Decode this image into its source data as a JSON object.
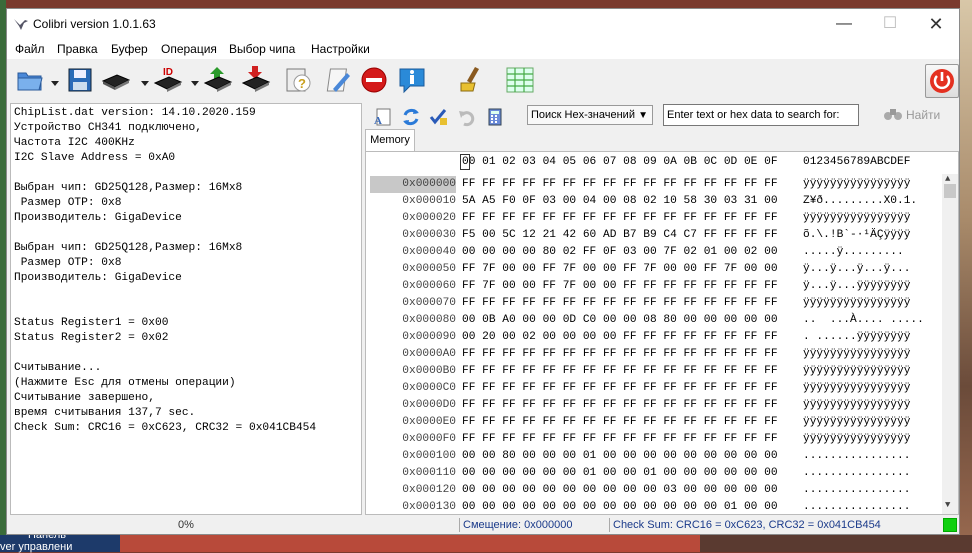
{
  "window": {
    "title": "Colibri version 1.0.1.63",
    "close_label": "✕",
    "min_label": "—",
    "max_label": "☐"
  },
  "menu": [
    "Файл",
    "Правка",
    "Буфер",
    "Операция",
    "Выбор чипа",
    "Настройки"
  ],
  "log_lines": [
    "ChipList.dat version: 14.10.2020.159",
    "Устройство CH341 подключено,",
    "Частота I2C 400KHz",
    "I2C Slave Address = 0xA0",
    "",
    "Выбран чип: GD25Q128,Размер: 16Mx8",
    " Размер OTP: 0x8",
    "Производитель: GigaDevice",
    "",
    "Выбран чип: GD25Q128,Размер: 16Mx8",
    " Размер OTP: 0x8",
    "Производитель: GigaDevice",
    "",
    "",
    "Status Register1 = 0x00",
    "Status Register2 = 0x02",
    "",
    "Считывание...",
    "(Нажмите Esc для отмены операции)",
    "Считывание завершено,",
    "время считывания 137,7 sec.",
    "Check Sum: CRC16 = 0xC623, CRC32 = 0x041CB454"
  ],
  "progress": "0%",
  "search": {
    "mode": "Поиск Hex-значений",
    "placeholder": "Enter text or hex data to search for:",
    "find_label": "Найти"
  },
  "tab": "Memory",
  "hex": {
    "columns": "00 01 02 03 04 05 06 07 08 09 0A 0B 0C 0D 0E 0F",
    "ascii_header": "0123456789ABCDEF",
    "rows": [
      {
        "addr": "0x000000",
        "bytes": "FF FF FF FF FF FF FF FF FF FF FF FF FF FF FF FF",
        "ascii": "ÿÿÿÿÿÿÿÿÿÿÿÿÿÿÿÿ"
      },
      {
        "addr": "0x000010",
        "bytes": "5A A5 F0 0F 03 00 04 00 08 02 10 58 30 03 31 00",
        "ascii": "Z¥ð.........X0.1."
      },
      {
        "addr": "0x000020",
        "bytes": "FF FF FF FF FF FF FF FF FF FF FF FF FF FF FF FF",
        "ascii": "ÿÿÿÿÿÿÿÿÿÿÿÿÿÿÿÿ"
      },
      {
        "addr": "0x000030",
        "bytes": "F5 00 5C 12 21 42 60 AD B7 B9 C4 C7 FF FF FF FF",
        "ascii": "õ.\\.!B`-·¹ÄÇÿÿÿÿ"
      },
      {
        "addr": "0x000040",
        "bytes": "00 00 00 00 80 02 FF 0F 03 00 7F 02 01 00 02 00",
        "ascii": ".....ÿ........."
      },
      {
        "addr": "0x000050",
        "bytes": "FF 7F 00 00 FF 7F 00 00 FF 7F 00 00 FF 7F 00 00",
        "ascii": "ÿ...ÿ...ÿ...ÿ..."
      },
      {
        "addr": "0x000060",
        "bytes": "FF 7F 00 00 FF 7F 00 00 FF FF FF FF FF FF FF FF",
        "ascii": "ÿ...ÿ...ÿÿÿÿÿÿÿÿ"
      },
      {
        "addr": "0x000070",
        "bytes": "FF FF FF FF FF FF FF FF FF FF FF FF FF FF FF FF",
        "ascii": "ÿÿÿÿÿÿÿÿÿÿÿÿÿÿÿÿ"
      },
      {
        "addr": "0x000080",
        "bytes": "00 0B A0 00 00 0D C0 00 00 08 80 00 00 00 00 00",
        "ascii": "..  ...À.... ....."
      },
      {
        "addr": "0x000090",
        "bytes": "00 20 00 02 00 00 00 00 FF FF FF FF FF FF FF FF",
        "ascii": ". ......ÿÿÿÿÿÿÿÿ"
      },
      {
        "addr": "0x0000A0",
        "bytes": "FF FF FF FF FF FF FF FF FF FF FF FF FF FF FF FF",
        "ascii": "ÿÿÿÿÿÿÿÿÿÿÿÿÿÿÿÿ"
      },
      {
        "addr": "0x0000B0",
        "bytes": "FF FF FF FF FF FF FF FF FF FF FF FF FF FF FF FF",
        "ascii": "ÿÿÿÿÿÿÿÿÿÿÿÿÿÿÿÿ"
      },
      {
        "addr": "0x0000C0",
        "bytes": "FF FF FF FF FF FF FF FF FF FF FF FF FF FF FF FF",
        "ascii": "ÿÿÿÿÿÿÿÿÿÿÿÿÿÿÿÿ"
      },
      {
        "addr": "0x0000D0",
        "bytes": "FF FF FF FF FF FF FF FF FF FF FF FF FF FF FF FF",
        "ascii": "ÿÿÿÿÿÿÿÿÿÿÿÿÿÿÿÿ"
      },
      {
        "addr": "0x0000E0",
        "bytes": "FF FF FF FF FF FF FF FF FF FF FF FF FF FF FF FF",
        "ascii": "ÿÿÿÿÿÿÿÿÿÿÿÿÿÿÿÿ"
      },
      {
        "addr": "0x0000F0",
        "bytes": "FF FF FF FF FF FF FF FF FF FF FF FF FF FF FF FF",
        "ascii": "ÿÿÿÿÿÿÿÿÿÿÿÿÿÿÿÿ"
      },
      {
        "addr": "0x000100",
        "bytes": "00 00 80 00 00 00 01 00 00 00 00 00 00 00 00 00",
        "ascii": "................"
      },
      {
        "addr": "0x000110",
        "bytes": "00 00 00 00 00 00 01 00 00 01 00 00 00 00 00 00",
        "ascii": "................"
      },
      {
        "addr": "0x000120",
        "bytes": "00 00 00 00 00 00 00 00 00 00 03 00 00 00 00 00",
        "ascii": "................"
      },
      {
        "addr": "0x000130",
        "bytes": "00 00 00 00 00 00 00 00 00 00 00 00 00 01 00 00",
        "ascii": "................"
      }
    ]
  },
  "status": {
    "offset": "Смещение: 0x000000",
    "checksum": "Check Sum: CRC16 = 0xC623, CRC32 = 0x041CB454"
  },
  "desktop": {
    "taskbar_label_1": "Панель",
    "taskbar_label_2": "ver управлени"
  },
  "colors": {
    "status_ok": "#10d010",
    "status_text": "#1a3a8a",
    "selected_row": "#c8c8c8"
  }
}
